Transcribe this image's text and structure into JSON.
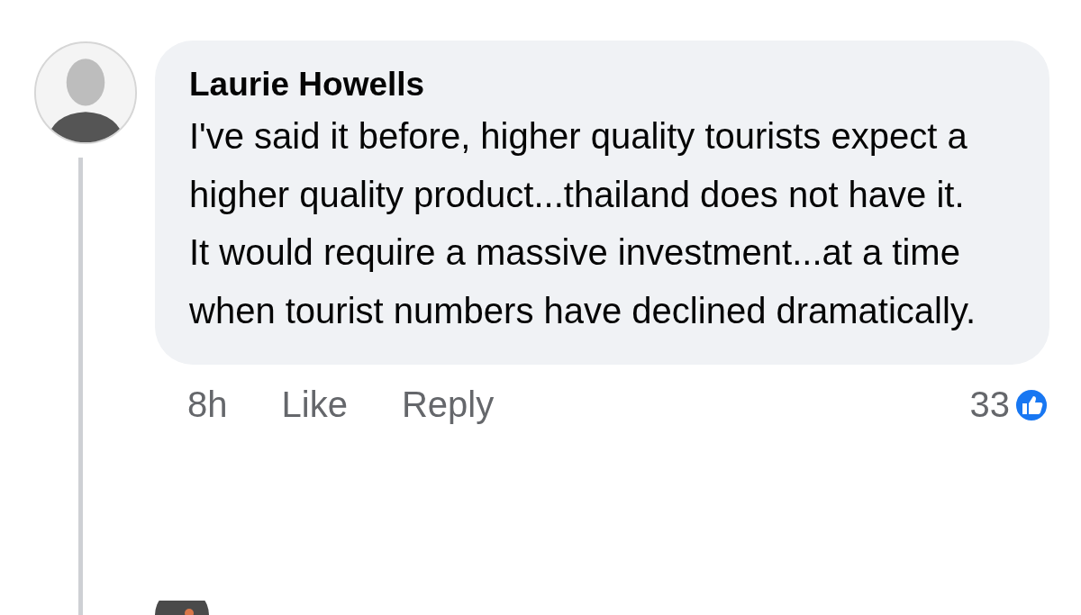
{
  "comment": {
    "author": "Laurie Howells",
    "text": "I've said it before, higher quality tourists expect a higher quality product...thailand does not have it. It would require a massive investment...at a time when tourist numbers have declined dramatically.",
    "time": "8h",
    "actions": [
      "Like",
      "Reply"
    ],
    "reaction_count": "33"
  }
}
